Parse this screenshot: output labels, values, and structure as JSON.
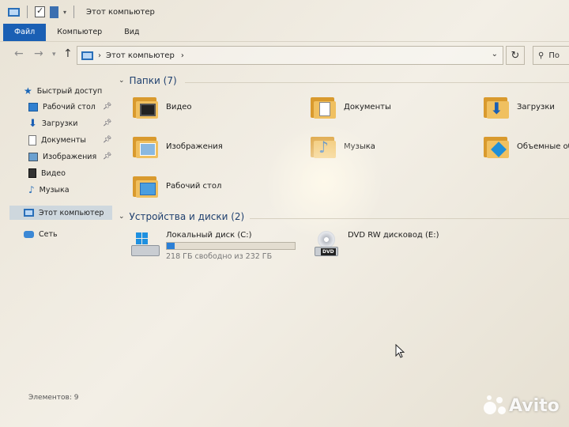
{
  "window": {
    "title": "Этот компьютер"
  },
  "ribbon": {
    "tabs": [
      {
        "label": "Файл"
      },
      {
        "label": "Компьютер"
      },
      {
        "label": "Вид"
      }
    ]
  },
  "navigation": {
    "back_icon": "back-arrow-icon",
    "forward_icon": "forward-arrow-icon",
    "address": "Этот компьютер",
    "search_placeholder": "По"
  },
  "sidebar": {
    "quick_access": "Быстрый доступ",
    "items": [
      {
        "label": "Рабочий стол",
        "icon": "desktop-icon",
        "pinned": true
      },
      {
        "label": "Загрузки",
        "icon": "downloads-icon",
        "pinned": true
      },
      {
        "label": "Документы",
        "icon": "documents-icon",
        "pinned": true
      },
      {
        "label": "Изображения",
        "icon": "pictures-icon",
        "pinned": true
      },
      {
        "label": "Видео",
        "icon": "video-icon",
        "pinned": false
      },
      {
        "label": "Музыка",
        "icon": "music-icon",
        "pinned": false
      }
    ],
    "this_pc": "Этот компьютер",
    "network": "Сеть"
  },
  "content": {
    "folders_header": "Папки (7)",
    "folders": [
      {
        "label": "Видео",
        "icon": "video-folder-icon"
      },
      {
        "label": "Документы",
        "icon": "documents-folder-icon"
      },
      {
        "label": "Загрузки",
        "icon": "downloads-folder-icon"
      },
      {
        "label": "Изображения",
        "icon": "pictures-folder-icon"
      },
      {
        "label": "Музыка",
        "icon": "music-folder-icon"
      },
      {
        "label": "Объемные объ",
        "icon": "3d-objects-folder-icon"
      },
      {
        "label": "Рабочий стол",
        "icon": "desktop-folder-icon"
      }
    ],
    "devices_header": "Устройства и диски (2)",
    "drives": [
      {
        "label": "Локальный диск (C:)",
        "free_text": "218 ГБ свободно из 232 ГБ",
        "used_fraction": 0.06
      },
      {
        "label": "DVD RW дисковод (E:)",
        "badge": "DVD"
      }
    ]
  },
  "status": {
    "items_count": "Элементов: 9"
  },
  "watermark": {
    "text": "Avito"
  },
  "colors": {
    "accent": "#1a5fb4",
    "header_text": "#1e3f6e",
    "drive_bar": "#2b7fd6",
    "folder": "#f0c060"
  }
}
